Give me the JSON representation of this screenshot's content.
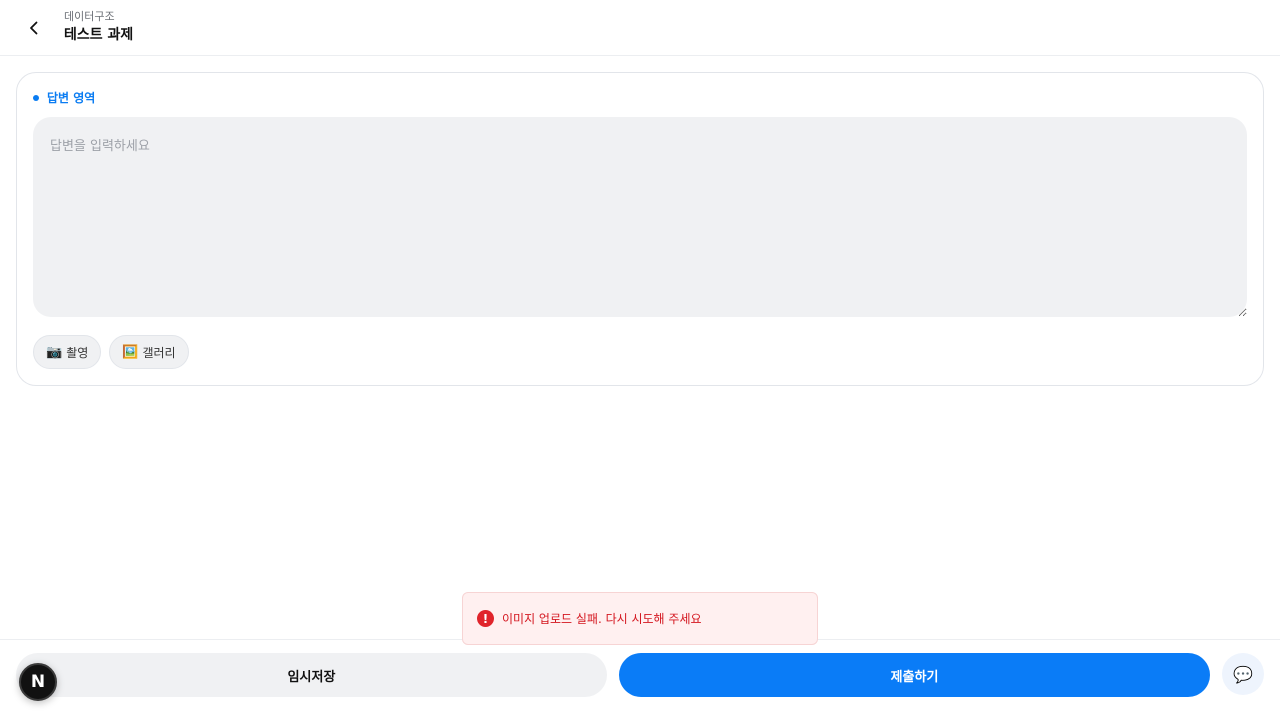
{
  "header": {
    "back_icon": "chevron-left-icon",
    "subtitle": "데이터구조",
    "title": "테스트 과제"
  },
  "answer_section": {
    "label": "답변 영역",
    "placeholder": "답변을 입력하세요",
    "value": "",
    "attach_buttons": [
      {
        "icon": "📷",
        "icon_name": "camera-icon",
        "label": "촬영"
      },
      {
        "icon": "🖼️",
        "icon_name": "gallery-icon",
        "label": "갤러리"
      }
    ]
  },
  "toast": {
    "icon": "!",
    "icon_name": "error-icon",
    "message": "이미지 업로드 실패. 다시 시도해 주세요"
  },
  "footer": {
    "save_label": "임시저장",
    "submit_label": "제출하기",
    "chat_icon": "💬",
    "badge_letter": "N"
  },
  "colors": {
    "accent": "#0a7cf7",
    "error": "#d4161f",
    "error_bg": "#fff0f0",
    "surface": "#f0f1f3"
  }
}
